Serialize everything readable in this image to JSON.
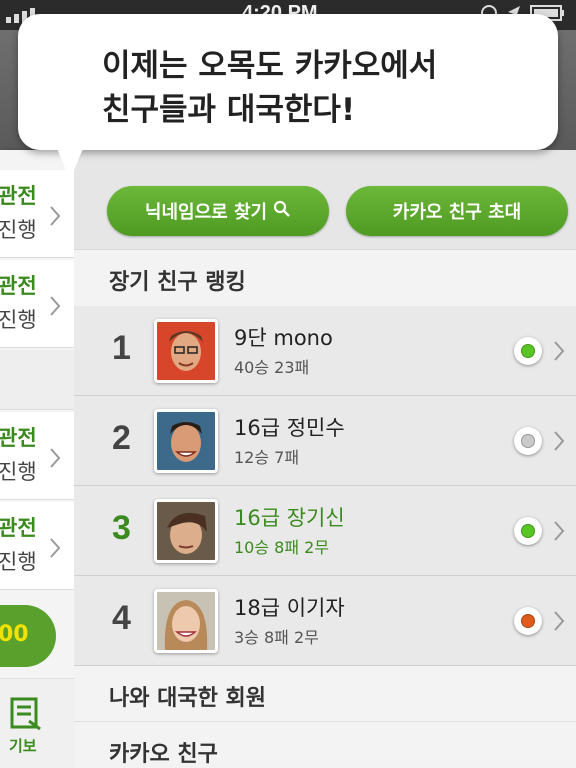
{
  "statusbar": {
    "time": "4:20 PM"
  },
  "bubble": {
    "line1": "이제는 오목도 카카오에서",
    "line2": "친구들과 대국한다!"
  },
  "left_panel": {
    "items": [
      {
        "line1": "관전",
        "line2": "진행"
      },
      {
        "line1": "관전",
        "line2": "진행"
      },
      {
        "line1": "관전",
        "line2": "진행"
      },
      {
        "line1": "관전",
        "line2": "진행"
      }
    ],
    "green_button": "00",
    "bottom_tab": {
      "label": "기보",
      "icon": "record-note-icon"
    }
  },
  "buttons": {
    "find_by_nickname": "닉네임으로 찾기",
    "invite_kakao": "카카오 친구 초대"
  },
  "sections": {
    "ranking_title": "장기 친구 랭킹",
    "played_members": "나와 대국한 회원",
    "kakao_friends": "카카오 친구"
  },
  "ranking": [
    {
      "rank": "1",
      "name": "9단 mono",
      "record": "40승 23패",
      "status_color": "#59c623"
    },
    {
      "rank": "2",
      "name": "16급 정민수",
      "record": "12승 7패",
      "status_color": "#c9c9c9"
    },
    {
      "rank": "3",
      "name": "16급 장기신",
      "record": "10승 8패 2무",
      "status_color": "#59c623"
    },
    {
      "rank": "4",
      "name": "18급 이기자",
      "record": "3승 8패 2무",
      "status_color": "#e05a1c"
    }
  ],
  "colors": {
    "accent_green": "#5aa02c",
    "highlight_text": "#3a8a1e"
  }
}
